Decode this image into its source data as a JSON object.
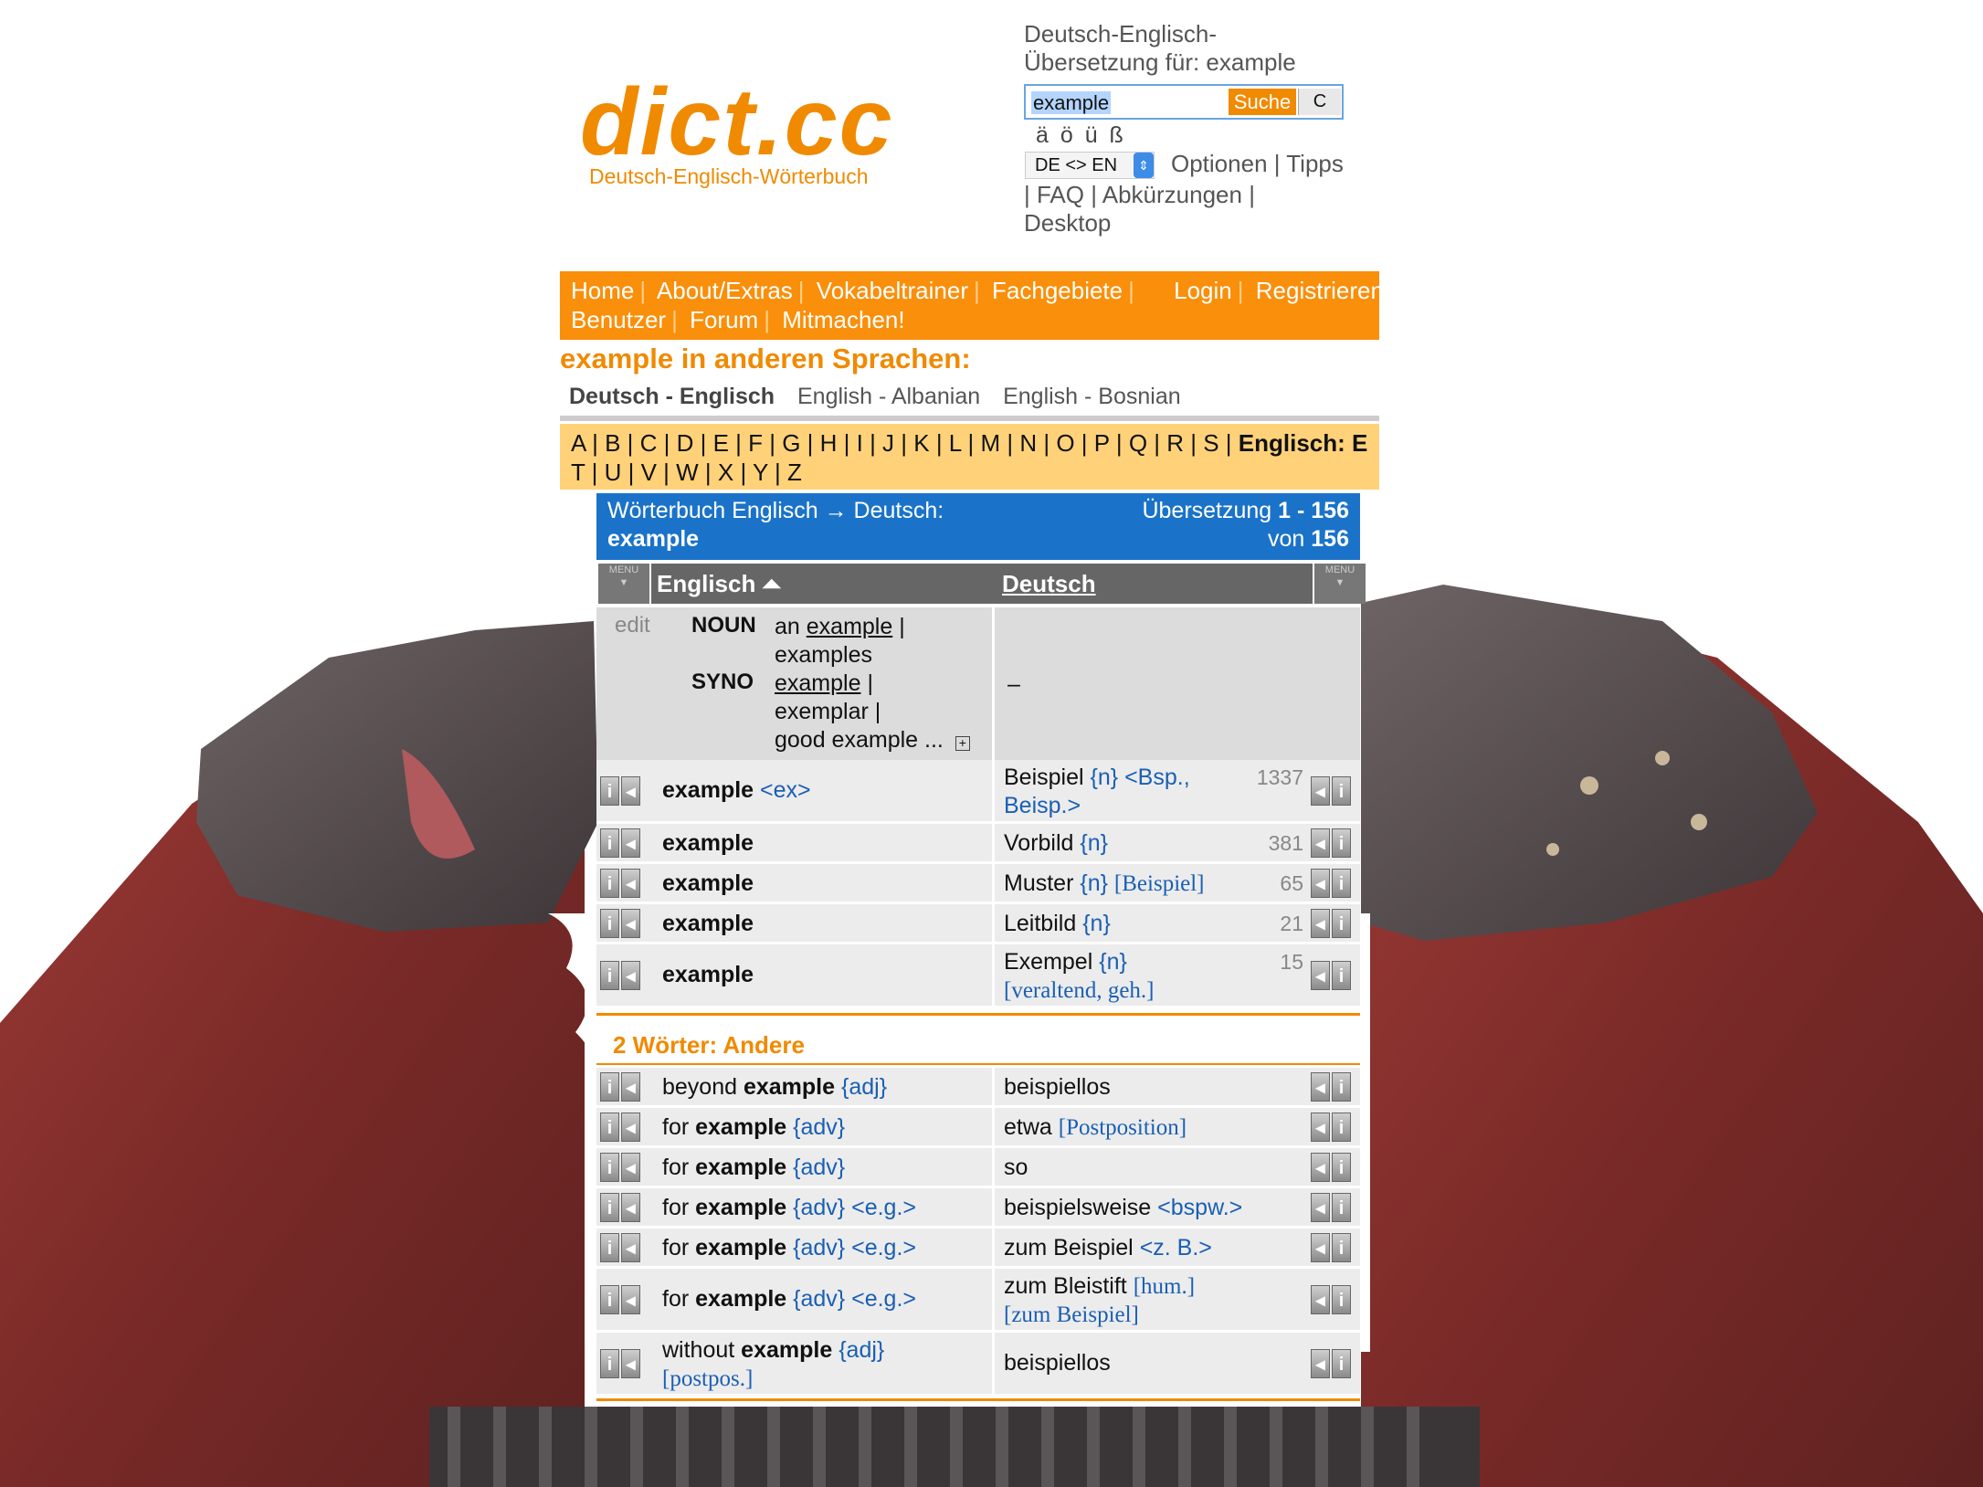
{
  "header": {
    "logo": "dict.cc",
    "logo_sub": "Deutsch-Englisch-Wörterbuch",
    "title_line1": "Deutsch-Englisch-",
    "title_line2": "Übersetzung für: example",
    "search_value": "example",
    "search_button": "Suche",
    "clear_button": "C",
    "umlauts": "ä ö ü ß",
    "lang_select": "DE <> EN",
    "options_line1": "Optionen | Tipps",
    "options_line2": "| FAQ | Abkürzungen |",
    "options_line3": "Desktop"
  },
  "nav": {
    "row1": [
      "Home",
      "About/Extras",
      "Vokabeltrainer",
      "Fachgebiete",
      "Login",
      "Registrieren"
    ],
    "row2": [
      "Benutzer",
      "Forum",
      "Mitmachen!"
    ]
  },
  "other_languages": {
    "title": "example in anderen Sprachen:",
    "items": [
      "Deutsch - Englisch",
      "English - Albanian",
      "English - Bosnian"
    ]
  },
  "alphabet": {
    "row1": "A | B | C | D | E | F | G | H | I | J | K | L | M | N | O | P | Q | R | S |",
    "row1_bold": "Englisch: E",
    "row2": "T | U | V | W | X | Y | Z"
  },
  "results": {
    "head_left1": "Wörterbuch Englisch → Deutsch:",
    "head_left2": "example",
    "head_right1_pre": "Übersetzung ",
    "head_right1_bold": "1 - 156",
    "head_right2_pre": "von ",
    "head_right2_bold": "156",
    "col_en": "Englisch",
    "col_de": "Deutsch",
    "menu_label": "MENU",
    "synonyms": {
      "edit": "edit",
      "noun_label": "NOUN",
      "noun_pre": "an ",
      "noun_link": "example",
      "noun_rest": " |",
      "noun_line2": "examples",
      "syno_label": "SYNO",
      "syno_link": "example",
      "syno_rest": " |",
      "syno_line2": "exemplar |",
      "syno_line3": "good example ...",
      "plus": "+",
      "de_dash": "–"
    },
    "rows": [
      {
        "en": "example",
        "en_tag": "<ex>",
        "de": "Beispiel",
        "de_tag": "{n}",
        "de_extra": "<Bsp., Beisp.>",
        "count": "1337"
      },
      {
        "en": "example",
        "de": "Vorbild",
        "de_tag": "{n}",
        "count": "381"
      },
      {
        "en": "example",
        "de": "Muster",
        "de_tag": "{n}",
        "de_extra": "[Beispiel]",
        "count": "65"
      },
      {
        "en": "example",
        "de": "Leitbild",
        "de_tag": "{n}",
        "count": "21"
      },
      {
        "en": "example",
        "de": "Exempel",
        "de_tag": "{n}",
        "de_extra": "[veraltend, geh.]",
        "count": "15"
      }
    ],
    "section2_title": "2 Wörter: Andere",
    "rows2": [
      {
        "en_pre": "beyond ",
        "en": "example",
        "en_tag": "{adj}",
        "de": "beispiellos"
      },
      {
        "en_pre": "for ",
        "en": "example",
        "en_tag": "{adv}",
        "de": "etwa",
        "de_extra": "[Postposition]"
      },
      {
        "en_pre": "for ",
        "en": "example",
        "en_tag": "{adv}",
        "de": "so"
      },
      {
        "en_pre": "for ",
        "en": "example",
        "en_tag": "{adv}",
        "en_extra": "<e.g.>",
        "de": "beispielsweise",
        "de_extra": "<bspw.>"
      },
      {
        "en_pre": "for ",
        "en": "example",
        "en_tag": "{adv}",
        "en_extra": "<e.g.>",
        "de": "zum Beispiel",
        "de_extra": "<z. B.>"
      },
      {
        "en_pre": "for ",
        "en": "example",
        "en_tag": "{adv}",
        "en_extra": "<e.g.>",
        "de": "zum Bleistift",
        "de_extra": "[hum.]",
        "de_extra2": "[zum Beispiel]"
      },
      {
        "en_pre": "without ",
        "en": "example",
        "en_tag": "{adj}",
        "en_extra2": "[postpos.]",
        "de": "beispiellos"
      }
    ]
  },
  "colors": {
    "orange": "#f08a00",
    "nav_orange": "#f98f0a",
    "blue": "#1a73c9",
    "alpha_bg": "#ffd27a"
  }
}
